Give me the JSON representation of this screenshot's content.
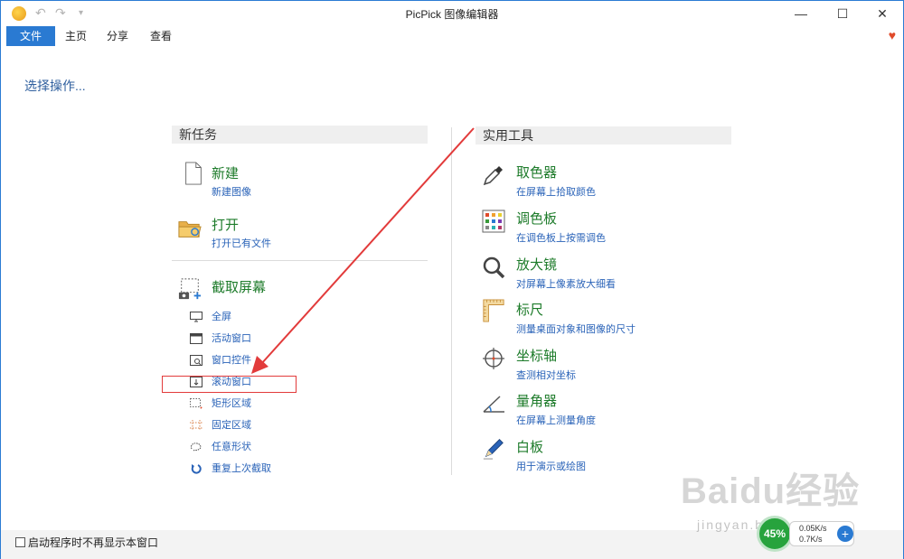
{
  "window": {
    "title": "PicPick 图像编辑器",
    "quick_access": {
      "undo_icon": "undo-icon",
      "redo_icon": "redo-icon",
      "customize_icon": "chevron-down-icon"
    },
    "controls": {
      "minimize": "—",
      "maximize": "☐",
      "close": "✕"
    }
  },
  "tabs": [
    {
      "label": "文件",
      "active": true
    },
    {
      "label": "主页",
      "active": false
    },
    {
      "label": "分享",
      "active": false
    },
    {
      "label": "查看",
      "active": false
    }
  ],
  "select_operation": "选择操作...",
  "new_task": {
    "header": "新任务",
    "new_item": {
      "title": "新建",
      "subtitle": "新建图像",
      "icon": "blank-page-icon"
    },
    "open_item": {
      "title": "打开",
      "subtitle": "打开已有文件",
      "icon": "folder-icon"
    },
    "capture": {
      "title": "截取屏幕",
      "icon": "screen-capture-icon",
      "items": [
        {
          "label": "全屏",
          "icon": "monitor-icon"
        },
        {
          "label": "活动窗口",
          "icon": "window-icon"
        },
        {
          "label": "窗口控件",
          "icon": "window-control-icon"
        },
        {
          "label": "滚动窗口",
          "icon": "scroll-window-icon"
        },
        {
          "label": "矩形区域",
          "icon": "rectangle-icon"
        },
        {
          "label": "固定区域",
          "icon": "fixed-area-icon"
        },
        {
          "label": "任意形状",
          "icon": "freehand-icon"
        },
        {
          "label": "重复上次截取",
          "icon": "repeat-icon"
        }
      ]
    }
  },
  "tools": {
    "header": "实用工具",
    "items": [
      {
        "title": "取色器",
        "subtitle": "在屏幕上拾取颜色",
        "icon": "eyedropper-icon"
      },
      {
        "title": "调色板",
        "subtitle": "在调色板上按需调色",
        "icon": "palette-icon"
      },
      {
        "title": "放大镜",
        "subtitle": "对屏幕上像素放大细看",
        "icon": "magnifier-icon"
      },
      {
        "title": "标尺",
        "subtitle": "测量桌面对象和图像的尺寸",
        "icon": "ruler-icon"
      },
      {
        "title": "坐标轴",
        "subtitle": "查测相对坐标",
        "icon": "crosshair-icon"
      },
      {
        "title": "量角器",
        "subtitle": "在屏幕上测量角度",
        "icon": "protractor-icon"
      },
      {
        "title": "白板",
        "subtitle": "用于演示或绘图",
        "icon": "pen-icon"
      }
    ]
  },
  "footer": {
    "checkbox_label": "启动程序时不再显示本窗口",
    "checked": false
  },
  "net_monitor": {
    "percent": "45%",
    "upload": "0.05K/s",
    "download": "0.7K/s"
  },
  "watermark": {
    "main": "Baidu经验",
    "sub": "jingyan.baidu.com"
  },
  "colors": {
    "accent": "#2a7ad2",
    "title_green": "#1d7b2a",
    "link_blue": "#2a63b8",
    "annotation_red": "#e23b3b"
  }
}
